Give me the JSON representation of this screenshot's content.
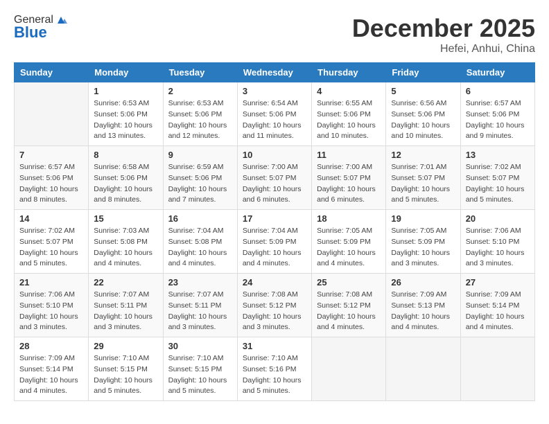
{
  "header": {
    "logo_general": "General",
    "logo_blue": "Blue",
    "month_year": "December 2025",
    "location": "Hefei, Anhui, China"
  },
  "days_of_week": [
    "Sunday",
    "Monday",
    "Tuesday",
    "Wednesday",
    "Thursday",
    "Friday",
    "Saturday"
  ],
  "weeks": [
    [
      {
        "day": "",
        "info": ""
      },
      {
        "day": "1",
        "info": "Sunrise: 6:53 AM\nSunset: 5:06 PM\nDaylight: 10 hours\nand 13 minutes."
      },
      {
        "day": "2",
        "info": "Sunrise: 6:53 AM\nSunset: 5:06 PM\nDaylight: 10 hours\nand 12 minutes."
      },
      {
        "day": "3",
        "info": "Sunrise: 6:54 AM\nSunset: 5:06 PM\nDaylight: 10 hours\nand 11 minutes."
      },
      {
        "day": "4",
        "info": "Sunrise: 6:55 AM\nSunset: 5:06 PM\nDaylight: 10 hours\nand 10 minutes."
      },
      {
        "day": "5",
        "info": "Sunrise: 6:56 AM\nSunset: 5:06 PM\nDaylight: 10 hours\nand 10 minutes."
      },
      {
        "day": "6",
        "info": "Sunrise: 6:57 AM\nSunset: 5:06 PM\nDaylight: 10 hours\nand 9 minutes."
      }
    ],
    [
      {
        "day": "7",
        "info": "Sunrise: 6:57 AM\nSunset: 5:06 PM\nDaylight: 10 hours\nand 8 minutes."
      },
      {
        "day": "8",
        "info": "Sunrise: 6:58 AM\nSunset: 5:06 PM\nDaylight: 10 hours\nand 8 minutes."
      },
      {
        "day": "9",
        "info": "Sunrise: 6:59 AM\nSunset: 5:06 PM\nDaylight: 10 hours\nand 7 minutes."
      },
      {
        "day": "10",
        "info": "Sunrise: 7:00 AM\nSunset: 5:07 PM\nDaylight: 10 hours\nand 6 minutes."
      },
      {
        "day": "11",
        "info": "Sunrise: 7:00 AM\nSunset: 5:07 PM\nDaylight: 10 hours\nand 6 minutes."
      },
      {
        "day": "12",
        "info": "Sunrise: 7:01 AM\nSunset: 5:07 PM\nDaylight: 10 hours\nand 5 minutes."
      },
      {
        "day": "13",
        "info": "Sunrise: 7:02 AM\nSunset: 5:07 PM\nDaylight: 10 hours\nand 5 minutes."
      }
    ],
    [
      {
        "day": "14",
        "info": "Sunrise: 7:02 AM\nSunset: 5:07 PM\nDaylight: 10 hours\nand 5 minutes."
      },
      {
        "day": "15",
        "info": "Sunrise: 7:03 AM\nSunset: 5:08 PM\nDaylight: 10 hours\nand 4 minutes."
      },
      {
        "day": "16",
        "info": "Sunrise: 7:04 AM\nSunset: 5:08 PM\nDaylight: 10 hours\nand 4 minutes."
      },
      {
        "day": "17",
        "info": "Sunrise: 7:04 AM\nSunset: 5:09 PM\nDaylight: 10 hours\nand 4 minutes."
      },
      {
        "day": "18",
        "info": "Sunrise: 7:05 AM\nSunset: 5:09 PM\nDaylight: 10 hours\nand 4 minutes."
      },
      {
        "day": "19",
        "info": "Sunrise: 7:05 AM\nSunset: 5:09 PM\nDaylight: 10 hours\nand 3 minutes."
      },
      {
        "day": "20",
        "info": "Sunrise: 7:06 AM\nSunset: 5:10 PM\nDaylight: 10 hours\nand 3 minutes."
      }
    ],
    [
      {
        "day": "21",
        "info": "Sunrise: 7:06 AM\nSunset: 5:10 PM\nDaylight: 10 hours\nand 3 minutes."
      },
      {
        "day": "22",
        "info": "Sunrise: 7:07 AM\nSunset: 5:11 PM\nDaylight: 10 hours\nand 3 minutes."
      },
      {
        "day": "23",
        "info": "Sunrise: 7:07 AM\nSunset: 5:11 PM\nDaylight: 10 hours\nand 3 minutes."
      },
      {
        "day": "24",
        "info": "Sunrise: 7:08 AM\nSunset: 5:12 PM\nDaylight: 10 hours\nand 3 minutes."
      },
      {
        "day": "25",
        "info": "Sunrise: 7:08 AM\nSunset: 5:12 PM\nDaylight: 10 hours\nand 4 minutes."
      },
      {
        "day": "26",
        "info": "Sunrise: 7:09 AM\nSunset: 5:13 PM\nDaylight: 10 hours\nand 4 minutes."
      },
      {
        "day": "27",
        "info": "Sunrise: 7:09 AM\nSunset: 5:14 PM\nDaylight: 10 hours\nand 4 minutes."
      }
    ],
    [
      {
        "day": "28",
        "info": "Sunrise: 7:09 AM\nSunset: 5:14 PM\nDaylight: 10 hours\nand 4 minutes."
      },
      {
        "day": "29",
        "info": "Sunrise: 7:10 AM\nSunset: 5:15 PM\nDaylight: 10 hours\nand 5 minutes."
      },
      {
        "day": "30",
        "info": "Sunrise: 7:10 AM\nSunset: 5:15 PM\nDaylight: 10 hours\nand 5 minutes."
      },
      {
        "day": "31",
        "info": "Sunrise: 7:10 AM\nSunset: 5:16 PM\nDaylight: 10 hours\nand 5 minutes."
      },
      {
        "day": "",
        "info": ""
      },
      {
        "day": "",
        "info": ""
      },
      {
        "day": "",
        "info": ""
      }
    ]
  ]
}
